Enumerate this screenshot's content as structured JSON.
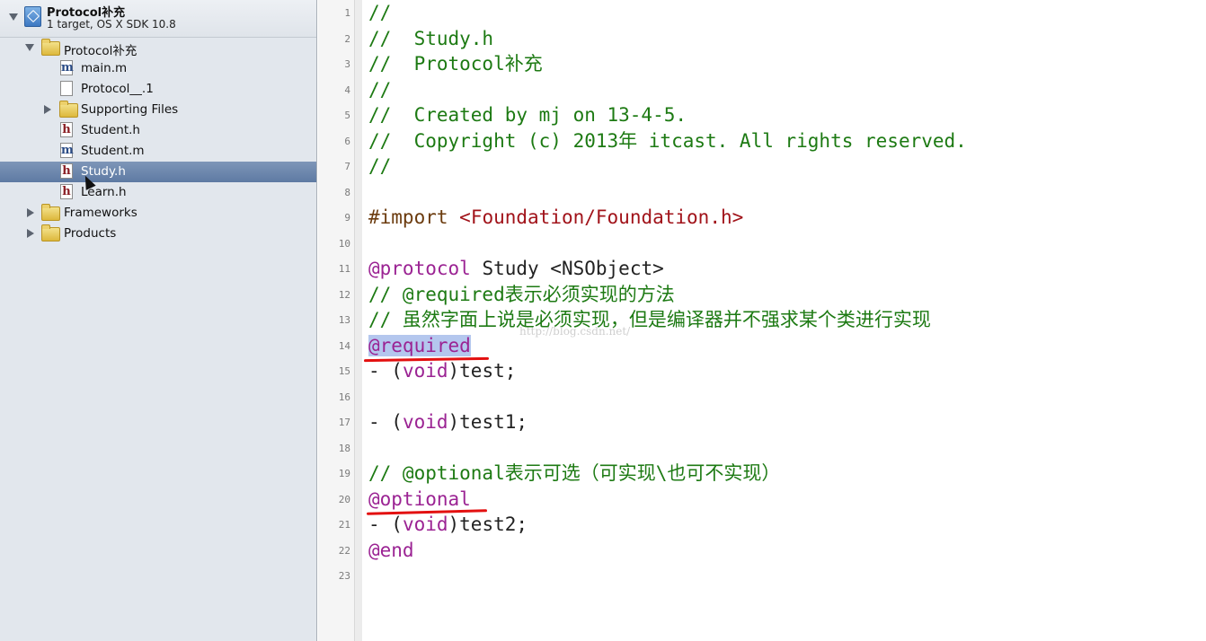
{
  "project": {
    "title": "Protocol补充",
    "subtitle": "1 target, OS X SDK 10.8"
  },
  "navigator": {
    "items": [
      {
        "label": "Protocol补充",
        "kind": "folder",
        "expanded": true
      },
      {
        "label": "main.m",
        "kind": "m"
      },
      {
        "label": "Protocol__.1",
        "kind": "doc"
      },
      {
        "label": "Supporting Files",
        "kind": "folder",
        "expanded": false
      },
      {
        "label": "Student.h",
        "kind": "h"
      },
      {
        "label": "Student.m",
        "kind": "m"
      },
      {
        "label": "Study.h",
        "kind": "h",
        "selected": true
      },
      {
        "label": "Learn.h",
        "kind": "h"
      },
      {
        "label": "Frameworks",
        "kind": "folder",
        "expanded": false
      },
      {
        "label": "Products",
        "kind": "folder",
        "expanded": false
      }
    ]
  },
  "editor": {
    "line_numbers": [
      "1",
      "2",
      "3",
      "4",
      "5",
      "6",
      "7",
      "8",
      "9",
      "10",
      "11",
      "12",
      "13",
      "14",
      "15",
      "16",
      "17",
      "18",
      "19",
      "20",
      "21",
      "22",
      "23"
    ],
    "lines": [
      "//",
      "//  Study.h",
      "//  Protocol补充",
      "//",
      "//  Created by mj on 13-4-5.",
      "//  Copyright (c) 2013年 itcast. All rights reserved.",
      "//",
      "",
      "#import",
      "<Foundation/Foundation.h>",
      "@protocol",
      "Study <NSObject>",
      "// @required表示必须实现的方法",
      "// 虽然字面上说是必须实现，但是编译器并不强求某个类进行实现",
      "@required",
      "- (",
      "void",
      ")test;",
      ")test1;",
      "// @optional表示可选（可实现\\也可不实现）",
      "@optional",
      ")test2;",
      "@end"
    ],
    "watermark": "http://blog.csdn.net/"
  },
  "colors": {
    "comment": "#1d7a13",
    "keyword": "#9b2393",
    "string": "#a1131a",
    "preprocessor": "#6b3b0e",
    "selection": "#b4c7ee",
    "annotation": "#e31010"
  }
}
